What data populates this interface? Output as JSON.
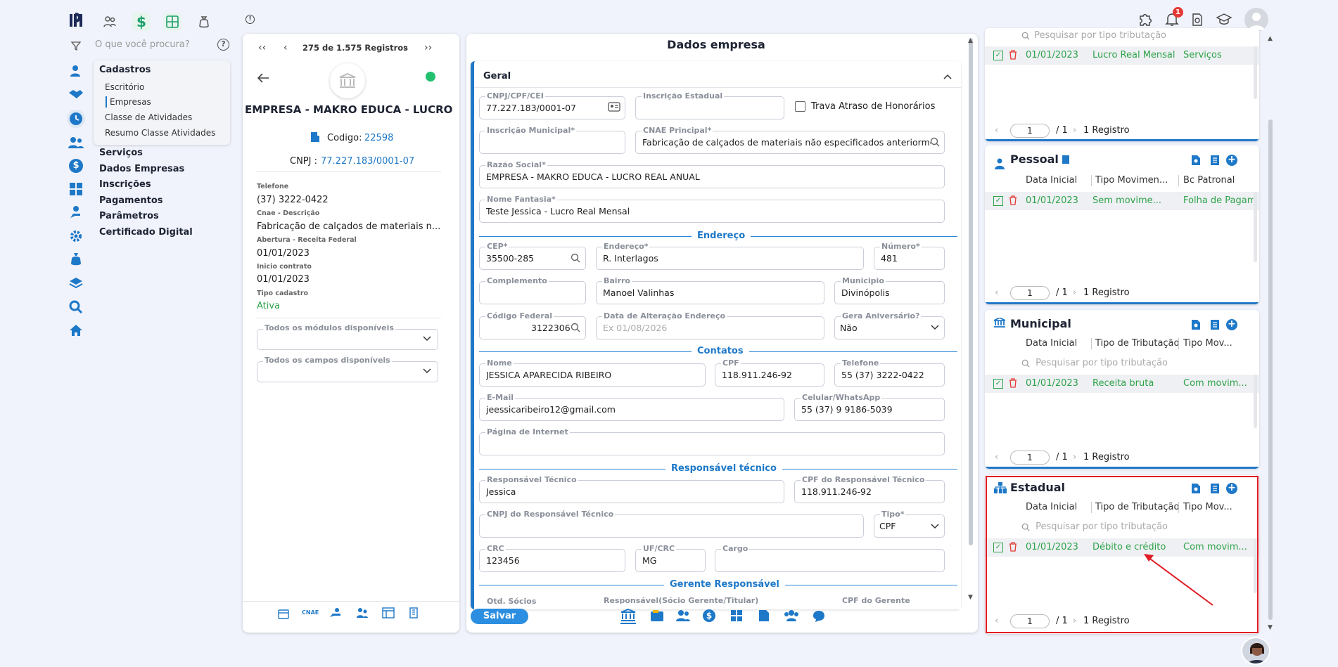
{
  "topbar": {
    "search_placeholder": "O que você procura?",
    "notif_count": "1"
  },
  "nav": {
    "cadastros_title": "Cadastros",
    "sub_items": [
      "Escritório",
      "Empresas",
      "Classe de Atividades",
      "Resumo Classe Atividades"
    ],
    "items": [
      "Serviços",
      "Dados Empresas",
      "Inscrições",
      "Pagamentos",
      "Parâmetros",
      "Certificado Digital"
    ]
  },
  "record": {
    "pager_text": "275 de 1.575 Registros",
    "company_name": "EMPRESA - MAKRO EDUCA - LUCRO ...",
    "codigo_label": "Codigo:",
    "codigo_value": "22598",
    "cnpj_label": "CNPJ :",
    "cnpj_value": "77.227.183/0001-07",
    "fields": [
      {
        "label": "Telefone",
        "value": "(37) 3222-0422"
      },
      {
        "label": "Cnae - Descrição",
        "value": "Fabricação de calçados de materiais n..."
      },
      {
        "label": "Abertura - Receita Federal",
        "value": "01/01/2023"
      },
      {
        "label": "Inicio contrato",
        "value": "01/01/2023"
      },
      {
        "label": "Tipo cadastro",
        "value": "Ativa"
      }
    ],
    "modules_placeholder": "Todos os módulos disponíveis",
    "fields_placeholder": "Todos os campos disponíveis"
  },
  "form": {
    "title": "Dados empresa",
    "section_geral": "Geral",
    "cnpj": {
      "label": "CNPJ/CPF/CEI",
      "value": "77.227.183/0001-07"
    },
    "ie": {
      "label": "Inscrição Estadual",
      "value": ""
    },
    "trava_label": "Trava Atraso de Honorários",
    "im": {
      "label": "Inscrição Municipal*",
      "value": ""
    },
    "cnae": {
      "label": "CNAE Principal*",
      "value": "Fabricação de calçados de materiais não especificados anteriormente"
    },
    "razao": {
      "label": "Razão Social*",
      "value": "EMPRESA - MAKRO EDUCA - LUCRO REAL ANUAL"
    },
    "fantasia": {
      "label": "Nome Fantasia*",
      "value": "Teste Jessica - Lucro Real Mensal"
    },
    "sec_endereco": "Endereço",
    "cep": {
      "label": "CEP*",
      "value": "35500-285"
    },
    "endereco": {
      "label": "Endereço*",
      "value": "R. Interlagos"
    },
    "numero": {
      "label": "Número*",
      "value": "481"
    },
    "complemento": {
      "label": "Complemento",
      "value": ""
    },
    "bairro": {
      "label": "Bairro",
      "value": "Manoel Valinhas"
    },
    "municipio": {
      "label": "Municipio",
      "value": "Divinópolis"
    },
    "codfed": {
      "label": "Código Federal",
      "value": "3122306"
    },
    "dataalt": {
      "label": "Data de Alteração Endereço",
      "placeholder": "Ex 01/08/2026"
    },
    "gera": {
      "label": "Gera Aniversário?",
      "value": "Não"
    },
    "sec_contatos": "Contatos",
    "nome": {
      "label": "Nome",
      "value": "JESSICA APARECIDA RIBEIRO"
    },
    "cpf": {
      "label": "CPF",
      "value": "118.911.246-92"
    },
    "telefone": {
      "label": "Telefone",
      "value": "55 (37) 3222-0422"
    },
    "email": {
      "label": "E-Mail",
      "value": "jeessicaribeiro12@gmail.com"
    },
    "celular": {
      "label": "Celular/WhatsApp",
      "value": "55 (37) 9 9186-5039"
    },
    "pagina": {
      "label": "Página de Internet",
      "value": ""
    },
    "sec_resp": "Responsável técnico",
    "resp": {
      "label": "Responsável Técnico",
      "value": "Jessica"
    },
    "cpfresp": {
      "label": "CPF do Responsável Técnico",
      "value": "118.911.246-92"
    },
    "cnpjresp": {
      "label": "CNPJ do Responsável Técnico",
      "value": ""
    },
    "tipo": {
      "label": "Tipo*",
      "value": "CPF"
    },
    "crc": {
      "label": "CRC",
      "value": "123456"
    },
    "ufcrc": {
      "label": "UF/CRC",
      "value": "MG"
    },
    "cargo": {
      "label": "Cargo",
      "value": ""
    },
    "sec_gerente": "Gerente Responsável",
    "qtd": {
      "label": "Qtd. Sócios"
    },
    "socio": {
      "label": "Responsável(Sócio Gerente/Titular)"
    },
    "cpfger": {
      "label": "CPF do Gerente"
    },
    "save_label": "Salvar"
  },
  "tributacao": {
    "top": {
      "search_placeholder": "Pesquisar por tipo tributação",
      "row": [
        "01/01/2023",
        "Lucro Real Mensal",
        "Serviços"
      ],
      "page": "1",
      "total": "/ 1",
      "count": "1 Registro"
    },
    "pessoal": {
      "title": "Pessoal",
      "headers": [
        "Data Inicial",
        "Tipo Movimen...",
        "Bc Patronal"
      ],
      "row": [
        "01/01/2023",
        "Sem movime...",
        "Folha de Pagame..."
      ],
      "page": "1",
      "total": "/ 1",
      "count": "1 Registro"
    },
    "municipal": {
      "title": "Municipal",
      "headers": [
        "Data Inicial",
        "Tipo de Tributação",
        "Tipo Mov..."
      ],
      "search_placeholder": "Pesquisar por tipo tributação",
      "row": [
        "01/01/2023",
        "Receita bruta",
        "Com movim..."
      ],
      "page": "1",
      "total": "/ 1",
      "count": "1 Registro"
    },
    "estadual": {
      "title": "Estadual",
      "headers": [
        "Data Inicial",
        "Tipo de Tributação",
        "Tipo Mov..."
      ],
      "search_placeholder": "Pesquisar por tipo tributação",
      "row": [
        "01/01/2023",
        "Débito e crédito",
        "Com movim..."
      ],
      "page": "1",
      "total": "/ 1",
      "count": "1 Registro"
    }
  },
  "colors": {
    "accent": "#1e78c8",
    "green": "#2fa34a",
    "highlight": "#e01b24"
  }
}
